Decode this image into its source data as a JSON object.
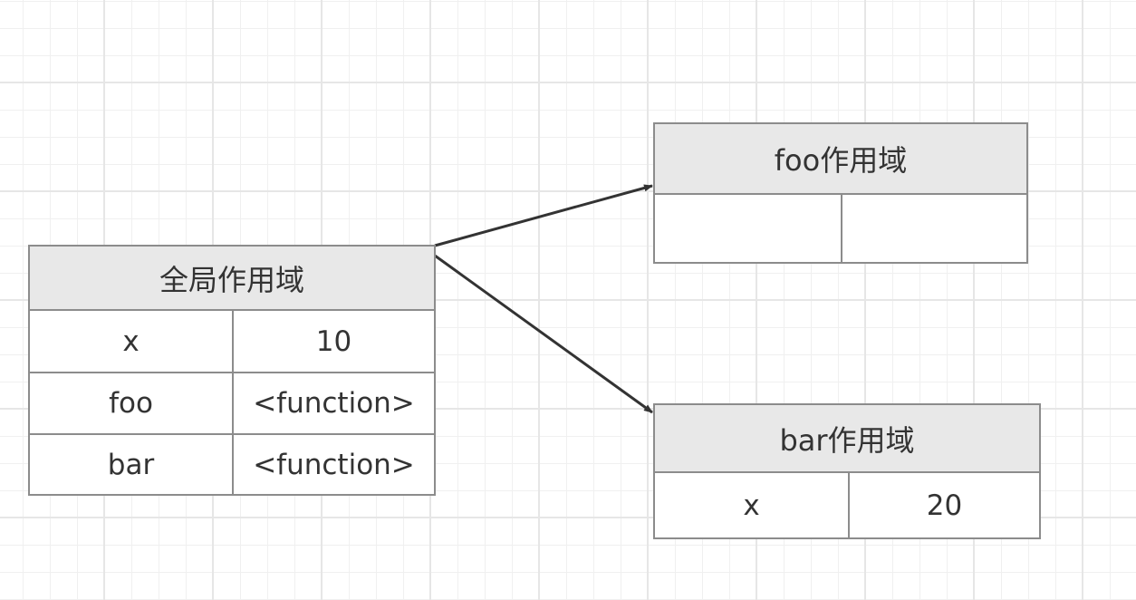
{
  "global_scope": {
    "title": "全局作用域",
    "rows": [
      {
        "key": "x",
        "value": "10"
      },
      {
        "key": "foo",
        "value": "<function>"
      },
      {
        "key": "bar",
        "value": "<function>"
      }
    ]
  },
  "foo_scope": {
    "title": "foo作用域",
    "rows": [
      {
        "key": "",
        "value": ""
      }
    ]
  },
  "bar_scope": {
    "title": "bar作用域",
    "rows": [
      {
        "key": "x",
        "value": "20"
      }
    ]
  },
  "colors": {
    "border": "#8c8c8c",
    "header": "#e8e8e8",
    "arrow": "#333333"
  }
}
